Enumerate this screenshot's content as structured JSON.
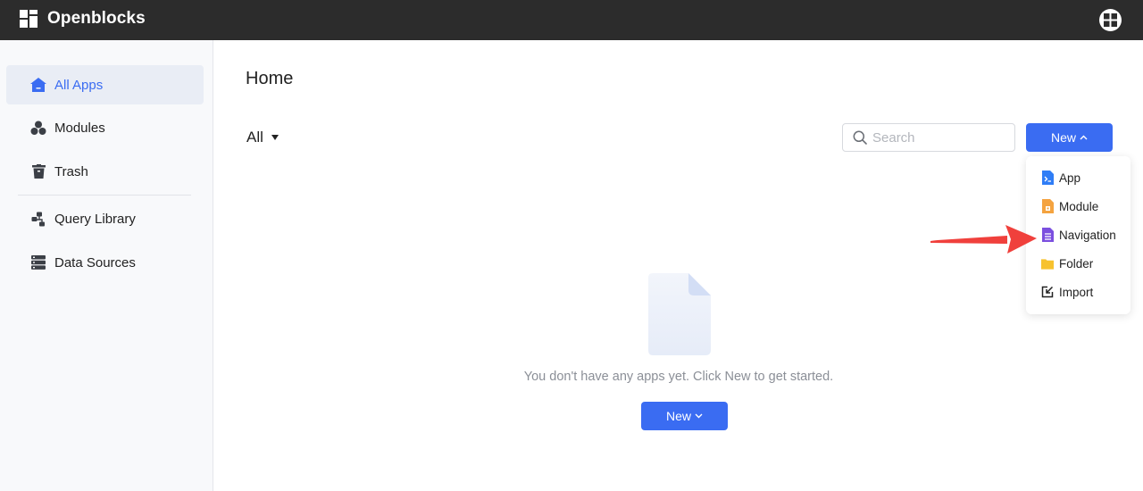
{
  "app": {
    "name": "Openblocks"
  },
  "sidebar": {
    "items": [
      {
        "label": "All Apps",
        "icon": "home-icon",
        "active": true
      },
      {
        "label": "Modules",
        "icon": "modules-icon"
      },
      {
        "label": "Trash",
        "icon": "trash-icon"
      },
      {
        "label": "Query Library",
        "icon": "query-library-icon"
      },
      {
        "label": "Data Sources",
        "icon": "data-sources-icon"
      }
    ]
  },
  "main": {
    "title": "Home",
    "filter": {
      "selected": "All"
    },
    "search": {
      "placeholder": "Search",
      "value": ""
    },
    "new_button": {
      "label": "New"
    },
    "new_menu": {
      "items": [
        {
          "label": "App",
          "icon": "app-icon",
          "color": "#2f7df6"
        },
        {
          "label": "Module",
          "icon": "module-icon",
          "color": "#f4a340"
        },
        {
          "label": "Navigation",
          "icon": "navigation-icon",
          "color": "#7b4fdf"
        },
        {
          "label": "Folder",
          "icon": "folder-icon",
          "color": "#f7c22e"
        },
        {
          "label": "Import",
          "icon": "import-icon",
          "color": "#222222"
        }
      ]
    },
    "empty_state": {
      "message": "You don't have any apps yet. Click New to get started.",
      "button_label": "New"
    }
  },
  "colors": {
    "accent": "#3a6cf2",
    "topbar": "#2c2c2c",
    "annotation_arrow": "#f0403c"
  }
}
